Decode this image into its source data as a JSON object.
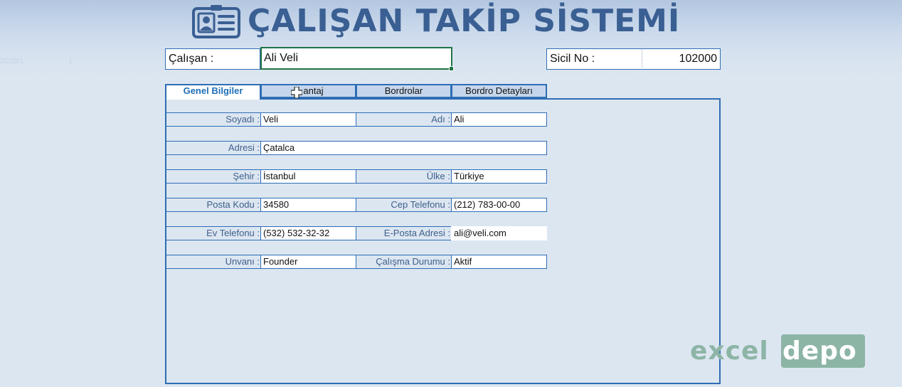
{
  "header": {
    "title": "ÇALIŞAN TAKİP SİSTEMİ",
    "icon": "id-card-icon",
    "faint_cell": "2028/1",
    "faint_cell2": "1"
  },
  "selectors": {
    "employee_label": "Çalışan :",
    "employee_value": "Ali Veli",
    "sicil_label": "Sicil No :",
    "sicil_value": "102000"
  },
  "tabs": [
    {
      "label": "Genel Bilgiler",
      "active": true
    },
    {
      "label": "antaj",
      "active": false
    },
    {
      "label": "Bordrolar",
      "active": false
    },
    {
      "label": "Bordro Detayları",
      "active": false
    }
  ],
  "form": {
    "rows": [
      {
        "left_label": "Soyadı :",
        "left_value": "Veli",
        "right_label": "Adı :",
        "right_value": "Ali"
      },
      {
        "left_label": "Adresi :",
        "left_value": "Çatalca"
      },
      {
        "left_label": "Şehir :",
        "left_value": "İstanbul",
        "right_label": "Ülke :",
        "right_value": "Türkiye"
      },
      {
        "left_label": "Posta Kodu :",
        "left_value": "34580",
        "right_label": "Cep Telefonu :",
        "right_value": "(212) 783-00-00"
      },
      {
        "left_label": "Ev Telefonu :",
        "left_value": "(532) 532-32-32",
        "right_label": "E-Posta Adresi :",
        "right_value": "ali@veli.com"
      },
      {
        "left_label": "Unvanı :",
        "left_value": "Founder",
        "right_label": "Çalışma Durumu :",
        "right_value": "Aktif"
      }
    ]
  },
  "brand": {
    "part1": "excel",
    "part2": "depo",
    "color": "#8db5a6"
  },
  "colors": {
    "accent": "#2e6db3",
    "title": "#3a5f93",
    "label": "#3e5f8a",
    "selection": "#217346"
  }
}
